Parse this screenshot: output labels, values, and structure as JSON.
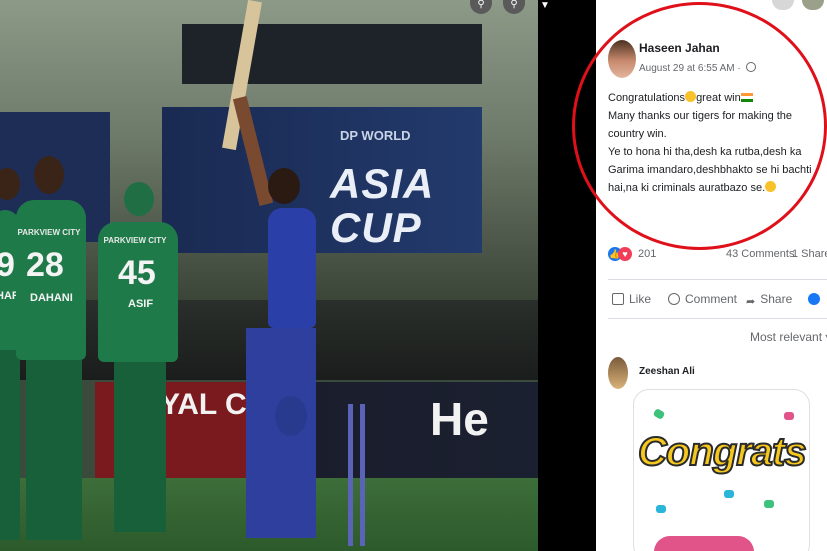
{
  "photo": {
    "banner_sponsor": "DP WORLD",
    "banner_line1": "ASIA",
    "banner_line2": "CUP",
    "board_left_text": "YAL C",
    "board_right_text": "He",
    "players": [
      {
        "club": "PARKVIEW CITY",
        "number": "28",
        "name": "DAHANI"
      },
      {
        "club": "PARKVIEW CITY",
        "number": "45",
        "name": "ASIF"
      },
      {
        "club": "",
        "number": "9",
        "name": "HAR"
      }
    ],
    "icons": [
      "search-icon",
      "search-icon",
      "chevron-down-icon"
    ]
  },
  "post": {
    "author": "Haseen Jahan",
    "timestamp": "August 29 at 6:55 AM",
    "line1_a": "Congratulations",
    "line1_b": "great win",
    "text_p1": "Many thanks our tigers for making the country win.",
    "text_p2": "Ye to hona hi tha,desh ka rutba,desh ka Garima imandaro,deshbhakto se hi bachti hai,na ki criminals auratbazo se.",
    "reaction_count": "201",
    "comments": "43 Comments",
    "shares": "1 Share",
    "actions": {
      "like": "Like",
      "comment": "Comment",
      "share": "Share"
    },
    "sort_label": "Most relevant",
    "highlight_color": "#e0101a"
  },
  "comment": {
    "author": "Zeeshan Ali",
    "sticker_text": "Congrats"
  },
  "colors": {
    "fb_blue": "#1877f2",
    "love_red": "#f33e58",
    "jersey_green": "#1f7a4a",
    "jersey_blue": "#2b3fa8"
  }
}
